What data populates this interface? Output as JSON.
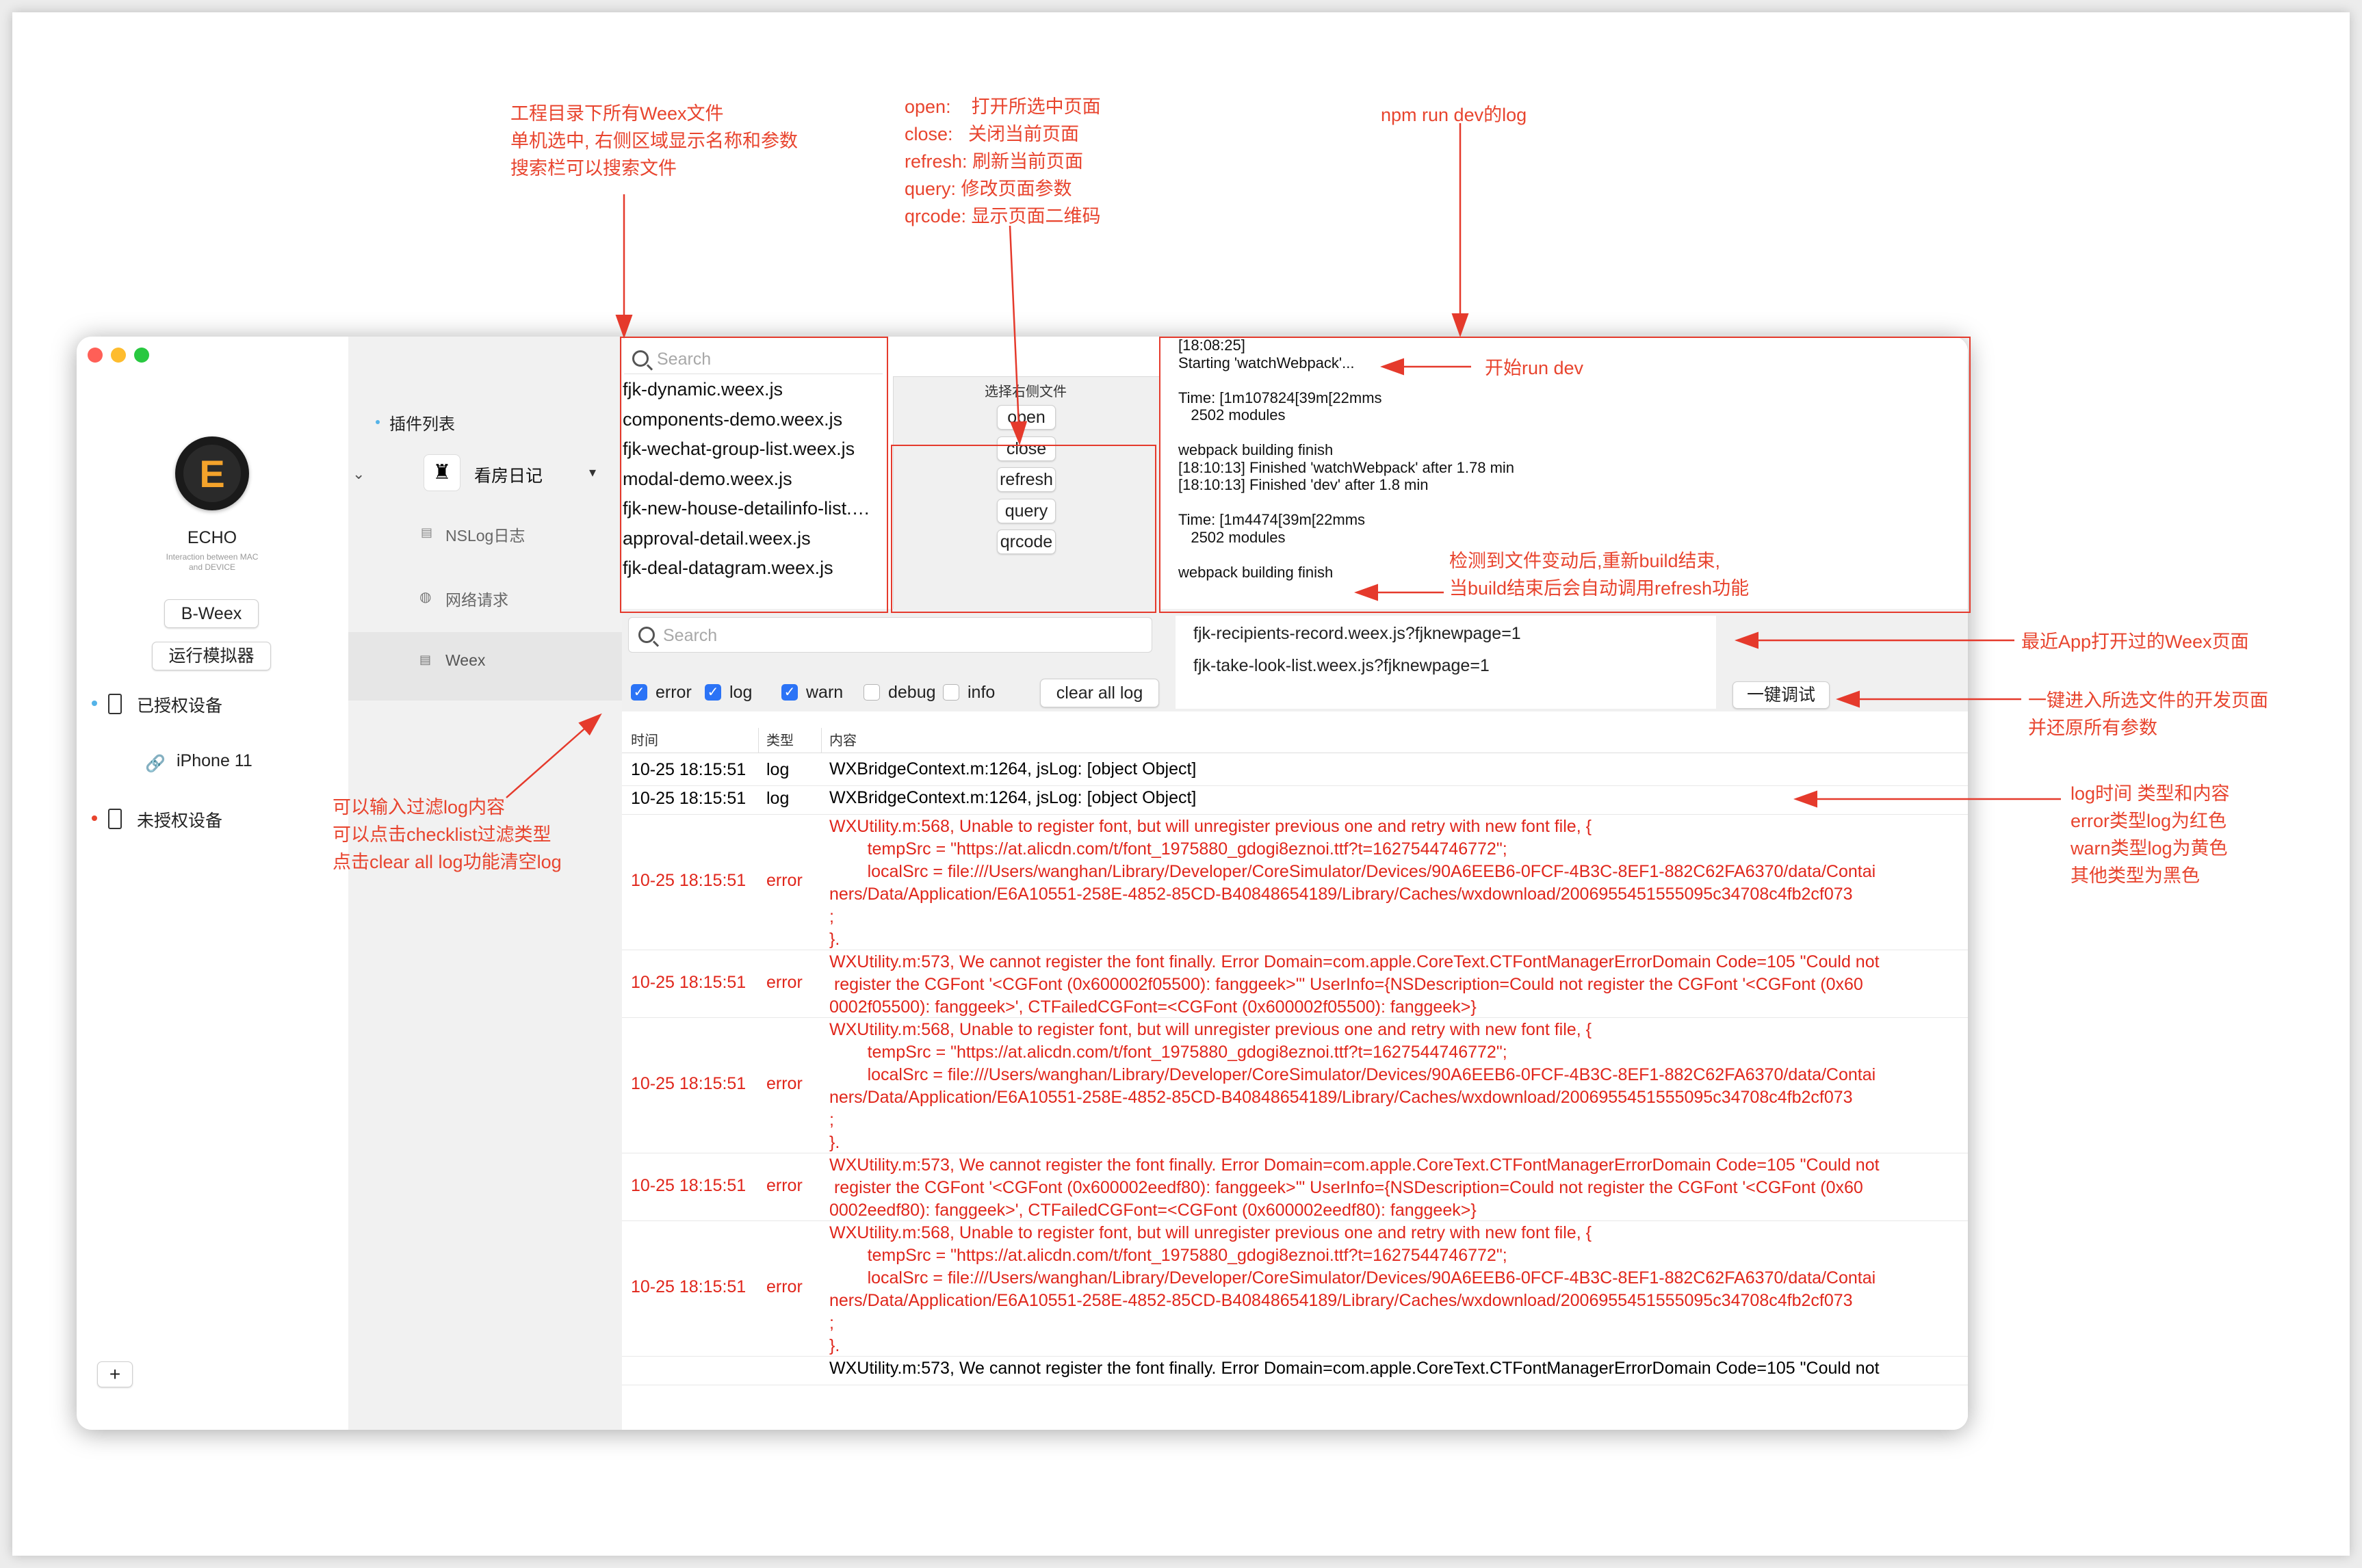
{
  "sidebar": {
    "app_name": "ECHO",
    "tagline": "Interaction between MAC and DEVICE",
    "logo_letter": "E",
    "buttons": [
      "B-Weex",
      "运行模拟器"
    ],
    "authorized_label": "已授权设备",
    "device_name": "iPhone 11",
    "unauthorized_label": "未授权设备",
    "add_label": "+"
  },
  "plugins": {
    "header": "插件列表",
    "app_name": "看房日记",
    "items": [
      "NSLog日志",
      "网络请求",
      "Weex"
    ]
  },
  "files": {
    "search_placeholder": "Search",
    "list": [
      "fjk-dynamic.weex.js",
      "components-demo.weex.js",
      "fjk-wechat-group-list.weex.js",
      "modal-demo.weex.js",
      "fjk-new-house-detailinfo-list.weex.js",
      "approval-detail.weex.js",
      "fjk-deal-datagram.weex.js"
    ]
  },
  "actions": {
    "hint": "选择右侧文件",
    "buttons": [
      "open",
      "close",
      "refresh",
      "query",
      "qrcode"
    ]
  },
  "devlog": {
    "lines": [
      "[18:08:25]",
      "Starting 'watchWebpack'...",
      "",
      "Time: [1m107824[39m[22mms",
      "   2502 modules",
      "",
      "webpack building finish",
      "[18:10:13] Finished 'watchWebpack' after 1.78 min",
      "[18:10:13] Finished 'dev' after 1.8 min",
      "",
      "Time: [1m4474[39m[22mms",
      "   2502 modules",
      "",
      "webpack building finish"
    ]
  },
  "filter": {
    "search_placeholder": "Search",
    "checks": [
      {
        "label": "error",
        "checked": true
      },
      {
        "label": "log",
        "checked": true
      },
      {
        "label": "warn",
        "checked": true
      },
      {
        "label": "debug",
        "checked": false
      },
      {
        "label": "info",
        "checked": false
      }
    ],
    "clear_label": "clear all log"
  },
  "recent": {
    "pages": [
      "fjk-recipients-record.weex.js?fjknewpage=1",
      "fjk-take-look-list.weex.js?fjknewpage=1"
    ],
    "debug_label": "一键调试"
  },
  "log_table": {
    "headers": [
      "时间",
      "类型",
      "内容"
    ],
    "rows": [
      {
        "time": "10-25 18:15:51",
        "type": "log",
        "lines": [
          "WXBridgeContext.m:1264, jsLog: [object Object]"
        ]
      },
      {
        "time": "10-25 18:15:51",
        "type": "log",
        "lines": [
          "WXBridgeContext.m:1264, jsLog: [object Object]"
        ]
      },
      {
        "time": "10-25 18:15:51",
        "type": "error",
        "lines": [
          "WXUtility.m:568, Unable to register font, but will unregister previous one and retry with new font file, {",
          "        tempSrc = \"https://at.alicdn.com/t/font_1975880_gdogi8eznoi.ttf?t=1627544746772\";",
          "        localSrc = file:///Users/wanghan/Library/Developer/CoreSimulator/Devices/90A6EEB6-0FCF-4B3C-8EF1-882C62FA6370/data/Contai",
          "ners/Data/Application/E6A10551-258E-4852-85CD-B40848654189/Library/Caches/wxdownload/2006955451555095c34708c4fb2cf073",
          ";",
          "}."
        ]
      },
      {
        "time": "10-25 18:15:51",
        "type": "error",
        "lines": [
          "WXUtility.m:573, We cannot register the font finally. Error Domain=com.apple.CoreText.CTFontManagerErrorDomain Code=105 \"Could not",
          " register the CGFont '<CGFont (0x600002f05500): fanggeek>'\" UserInfo={NSDescription=Could not register the CGFont '<CGFont (0x60",
          "0002f05500): fanggeek>', CTFailedCGFont=<CGFont (0x600002f05500): fanggeek>}"
        ]
      },
      {
        "time": "10-25 18:15:51",
        "type": "error",
        "lines": [
          "WXUtility.m:568, Unable to register font, but will unregister previous one and retry with new font file, {",
          "        tempSrc = \"https://at.alicdn.com/t/font_1975880_gdogi8eznoi.ttf?t=1627544746772\";",
          "        localSrc = file:///Users/wanghan/Library/Developer/CoreSimulator/Devices/90A6EEB6-0FCF-4B3C-8EF1-882C62FA6370/data/Contai",
          "ners/Data/Application/E6A10551-258E-4852-85CD-B40848654189/Library/Caches/wxdownload/2006955451555095c34708c4fb2cf073",
          ";",
          "}."
        ]
      },
      {
        "time": "10-25 18:15:51",
        "type": "error",
        "lines": [
          "WXUtility.m:573, We cannot register the font finally. Error Domain=com.apple.CoreText.CTFontManagerErrorDomain Code=105 \"Could not",
          " register the CGFont '<CGFont (0x600002eedf80): fanggeek>'\" UserInfo={NSDescription=Could not register the CGFont '<CGFont (0x60",
          "0002eedf80): fanggeek>', CTFailedCGFont=<CGFont (0x600002eedf80): fanggeek>}"
        ]
      },
      {
        "time": "10-25 18:15:51",
        "type": "error",
        "lines": [
          "WXUtility.m:568, Unable to register font, but will unregister previous one and retry with new font file, {",
          "        tempSrc = \"https://at.alicdn.com/t/font_1975880_gdogi8eznoi.ttf?t=1627544746772\";",
          "        localSrc = file:///Users/wanghan/Library/Developer/CoreSimulator/Devices/90A6EEB6-0FCF-4B3C-8EF1-882C62FA6370/data/Contai",
          "ners/Data/Application/E6A10551-258E-4852-85CD-B40848654189/Library/Caches/wxdownload/2006955451555095c34708c4fb2cf073",
          ";",
          "}."
        ]
      },
      {
        "time": "",
        "type": "",
        "lines": [
          "WXUtility.m:573, We cannot register the font finally. Error Domain=com.apple.CoreText.CTFontManagerErrorDomain Code=105 \"Could not"
        ]
      }
    ]
  },
  "annotations": {
    "files_note": [
      "工程目录下所有Weex文件",
      "单机选中, 右侧区域显示名称和参数",
      "搜索栏可以搜索文件"
    ],
    "actions_note": [
      "open:    打开所选中页面",
      "close:   关闭当前页面",
      "refresh: 刷新当前页面",
      "query: 修改页面参数",
      "qrcode: 显示页面二维码"
    ],
    "devlog_note": "npm run dev的log",
    "start_note": "开始run dev",
    "build_note": [
      "检测到文件变动后,重新build结束,",
      "当build结束后会自动调用refresh功能"
    ],
    "recent_note": "最近App打开过的Weex页面",
    "debug_note": [
      "一键进入所选文件的开发页面",
      "并还原所有参数"
    ],
    "filter_note": [
      "可以输入过滤log内容",
      "可以点击checklist过滤类型",
      "点击clear all log功能清空log"
    ],
    "log_note": [
      "log时间 类型和内容",
      "error类型log为红色",
      "warn类型log为黄色",
      "其他类型为黑色"
    ]
  },
  "colors": {
    "accent": "#2b73f6",
    "error_red": "#e0261b",
    "annotation_red": "#e8442e",
    "traffic_red": "#ff5f57",
    "traffic_yellow": "#febc2e",
    "traffic_green": "#28c840"
  }
}
